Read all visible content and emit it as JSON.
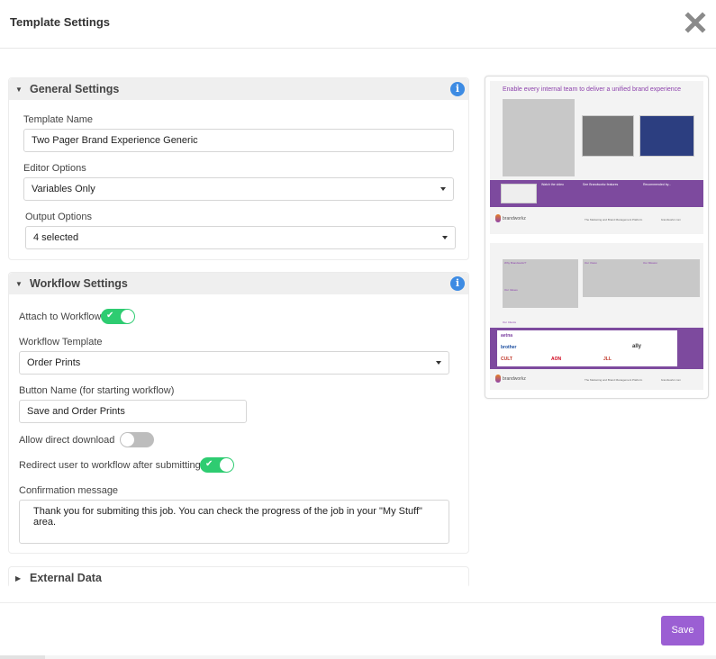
{
  "dialog": {
    "title": "Template Settings",
    "close_icon": "close-x-icon"
  },
  "general": {
    "title": "General Settings",
    "template_name_label": "Template Name",
    "template_name_value": "Two Pager Brand Experience Generic",
    "editor_options_label": "Editor Options",
    "editor_options_value": "Variables Only",
    "output_options_label": "Output Options",
    "output_options_value": "4 selected"
  },
  "workflow": {
    "title": "Workflow Settings",
    "attach_label": "Attach to Workflow",
    "attach_on": true,
    "template_label": "Workflow Template",
    "template_value": "Order Prints",
    "button_name_label": "Button Name (for starting workflow)",
    "button_name_value": "Save and Order Prints",
    "direct_download_label": "Allow direct download",
    "direct_download_on": false,
    "redirect_label": "Redirect user to workflow after submitting",
    "redirect_on": true,
    "confirmation_label": "Confirmation message",
    "confirmation_value": "Thank you for submiting this job. You can check the progress of the job in your \"My Stuff\" area."
  },
  "external": {
    "title": "External Data"
  },
  "footer": {
    "save_label": "Save"
  },
  "preview": {
    "page1_title": "Enable every internal team to deliver a unified brand experience",
    "watch_video": "Watch the video",
    "see_features": "See Brandworkz features",
    "recommended": "Recommended by...",
    "brand": "brandworkz",
    "tagline": "The Marketing and Brand Management Platform",
    "url": "brandworkz.com",
    "why": "Why Brandworkz?",
    "vision": "Our Vision",
    "mission": "Our Mission",
    "values": "Our Values",
    "clients_label": "Our Clients",
    "clients": [
      "aetna",
      "brother",
      "CULT",
      "ally",
      "AON",
      "JLL"
    ]
  },
  "colors": {
    "accent": "#9b5fd3",
    "toggle_on": "#2ecc71",
    "info": "#3d8be3",
    "brand_purple": "#7d4a9e"
  }
}
